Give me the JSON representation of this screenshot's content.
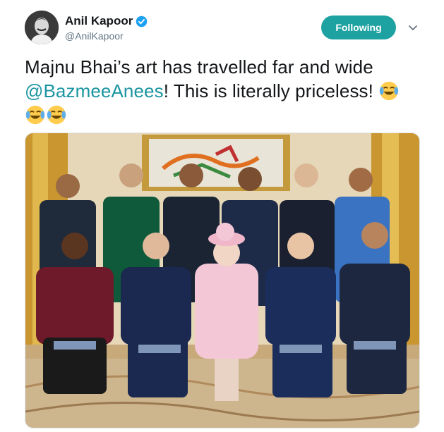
{
  "author": {
    "display_name": "Anil Kapoor",
    "handle": "@AnilKapoor",
    "verified": true
  },
  "actions": {
    "follow_label": "Following"
  },
  "tweet": {
    "text_part1": "Majnu Bhai’s art has travelled far and wide ",
    "mention": "@BazmeeAnees",
    "text_part2": "! This is literally priceless!",
    "emoji": "face-with-tears-of-joy"
  },
  "colors": {
    "accent": "#1b95a0",
    "follow_button": "#1da1a1",
    "verified_badge": "#1da1f2"
  }
}
